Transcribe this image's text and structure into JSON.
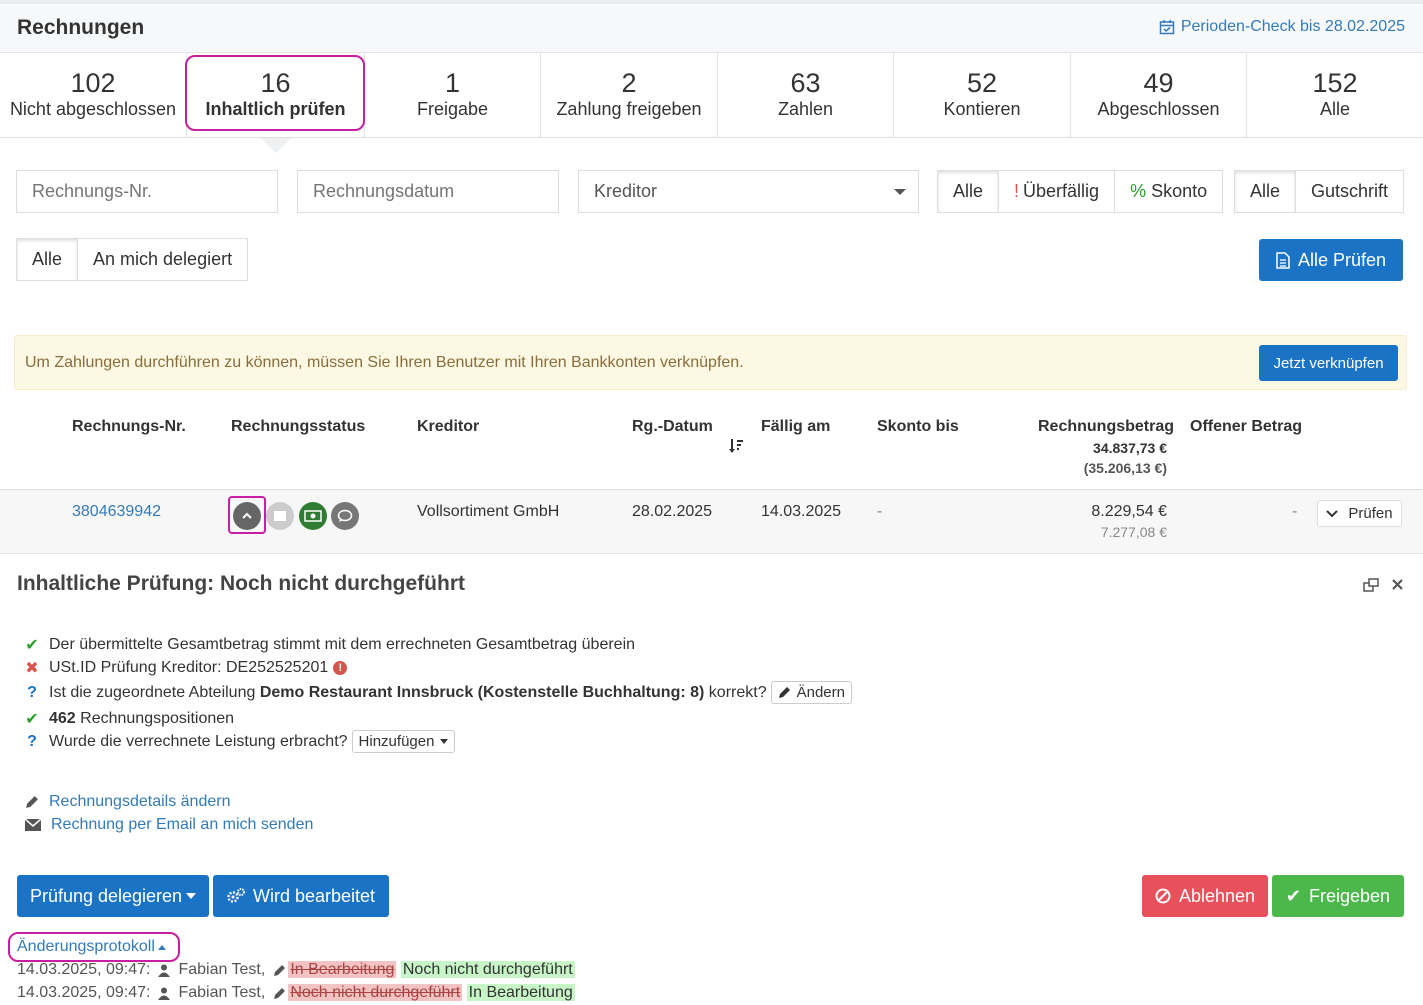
{
  "header": {
    "title": "Rechnungen",
    "period_check": "Perioden-Check bis 28.02.2025"
  },
  "tabs": [
    {
      "num": "102",
      "label": "Nicht abgeschlossen"
    },
    {
      "num": "16",
      "label": "Inhaltlich prüfen"
    },
    {
      "num": "1",
      "label": "Freigabe"
    },
    {
      "num": "2",
      "label": "Zahlung freigeben"
    },
    {
      "num": "63",
      "label": "Zahlen"
    },
    {
      "num": "52",
      "label": "Kontieren"
    },
    {
      "num": "49",
      "label": "Abgeschlossen"
    },
    {
      "num": "152",
      "label": "Alle"
    }
  ],
  "filters": {
    "invoice_no_placeholder": "Rechnungs-Nr.",
    "date_placeholder": "Rechnungsdatum",
    "creditor_select": "Kreditor",
    "status_group": [
      "Alle",
      "Überfällig",
      "Skonto"
    ],
    "type_group": [
      "Alle",
      "Gutschrift"
    ],
    "delegation_group": [
      "Alle",
      "An mich delegiert"
    ],
    "check_all": "Alle Prüfen"
  },
  "alert": {
    "text": "Um Zahlungen durchführen zu können, müssen Sie Ihren Benutzer mit Ihren Bankkonten verknüpfen.",
    "button": "Jetzt verknüpfen"
  },
  "table": {
    "headers": {
      "invoice_no": "Rechnungs-Nr.",
      "status": "Rechnungsstatus",
      "creditor": "Kreditor",
      "date": "Rg.-Datum",
      "due": "Fällig am",
      "discount": "Skonto bis",
      "amount": "Rechnungsbetrag",
      "amount_total": "34.837,73 €",
      "amount_total2": "(35.206,13 €)",
      "open": "Offener Betrag"
    },
    "row": {
      "invoice_no": "3804639942",
      "creditor": "Vollsortiment GmbH",
      "date": "28.02.2025",
      "due": "14.03.2025",
      "discount": "-",
      "amount": "8.229,54 €",
      "amount_net": "7.277,08 €",
      "open": "-",
      "action": "Prüfen"
    }
  },
  "panel": {
    "title": "Inhaltliche Prüfung: Noch nicht durchgeführt",
    "checks": {
      "c1": "Der übermittelte Gesamtbetrag stimmt mit dem errechneten Gesamtbetrag überein",
      "c2": "USt.ID Prüfung Kreditor: DE252525201",
      "c3_pre": "Ist die zugeordnete Abteilung",
      "c3_bold": "Demo Restaurant Innsbruck (Kostenstelle Buchhaltung: 8)",
      "c3_post": "korrekt?",
      "c3_btn": "Ändern",
      "c4_bold": "462",
      "c4_text": "Rechnungspositionen",
      "c5": "Wurde die verrechnete Leistung erbracht?",
      "c5_btn": "Hinzufügen"
    },
    "links": {
      "edit": "Rechnungsdetails ändern",
      "email": "Rechnung per Email an mich senden"
    },
    "buttons": {
      "delegate": "Prüfung delegieren",
      "processing": "Wird bearbeitet",
      "reject": "Ablehnen",
      "approve": "Freigeben"
    },
    "log_title": "Änderungsprotokoll",
    "log": [
      {
        "time": "14.03.2025, 09:47:",
        "user": "Fabian Test,",
        "old": "In Bearbeitung",
        "new": "Noch nicht durchgeführt"
      },
      {
        "time": "14.03.2025, 09:47:",
        "user": "Fabian Test,",
        "old": "Noch nicht durchgeführt",
        "new": "In Bearbeitung"
      }
    ]
  },
  "colors": {
    "primary": "#1a73c4",
    "danger": "#e8505b",
    "success": "#4cb84c",
    "highlight": "#c71f9f"
  }
}
